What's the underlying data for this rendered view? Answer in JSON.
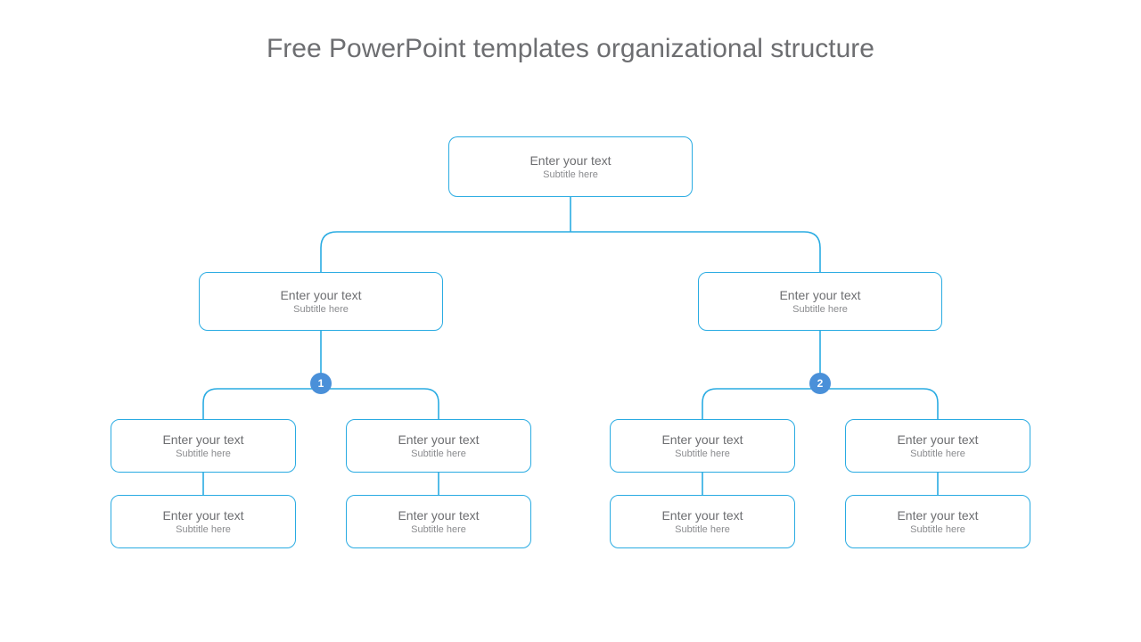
{
  "page": {
    "title": "Free PowerPoint templates organizational structure"
  },
  "colors": {
    "border": "#29abe2",
    "badge": "#4a90d9",
    "text": "#6d6e71",
    "sub": "#8a8b8e"
  },
  "nodes": {
    "root": {
      "title": "Enter your text",
      "subtitle": "Subtitle here"
    },
    "left": {
      "title": "Enter your text",
      "subtitle": "Subtitle here",
      "badge": "1"
    },
    "right": {
      "title": "Enter your text",
      "subtitle": "Subtitle here",
      "badge": "2"
    },
    "l1": {
      "title": "Enter your text",
      "subtitle": "Subtitle here"
    },
    "l2": {
      "title": "Enter your text",
      "subtitle": "Subtitle here"
    },
    "l3": {
      "title": "Enter your text",
      "subtitle": "Subtitle here"
    },
    "l4": {
      "title": "Enter your text",
      "subtitle": "Subtitle here"
    },
    "r1": {
      "title": "Enter your text",
      "subtitle": "Subtitle here"
    },
    "r2": {
      "title": "Enter your text",
      "subtitle": "Subtitle here"
    },
    "r3": {
      "title": "Enter your text",
      "subtitle": "Subtitle here"
    },
    "r4": {
      "title": "Enter your text",
      "subtitle": "Subtitle here"
    }
  },
  "chart_data": {
    "type": "tree",
    "title": "Free PowerPoint templates organizational structure",
    "root": {
      "title": "Enter your text",
      "subtitle": "Subtitle here",
      "children": [
        {
          "title": "Enter your text",
          "subtitle": "Subtitle here",
          "badge": "1",
          "children": [
            {
              "title": "Enter your text",
              "subtitle": "Subtitle here",
              "children": [
                {
                  "title": "Enter your text",
                  "subtitle": "Subtitle here"
                }
              ]
            },
            {
              "title": "Enter your text",
              "subtitle": "Subtitle here",
              "children": [
                {
                  "title": "Enter your text",
                  "subtitle": "Subtitle here"
                }
              ]
            }
          ]
        },
        {
          "title": "Enter your text",
          "subtitle": "Subtitle here",
          "badge": "2",
          "children": [
            {
              "title": "Enter your text",
              "subtitle": "Subtitle here",
              "children": [
                {
                  "title": "Enter your text",
                  "subtitle": "Subtitle here"
                }
              ]
            },
            {
              "title": "Enter your text",
              "subtitle": "Subtitle here",
              "children": [
                {
                  "title": "Enter your text",
                  "subtitle": "Subtitle here"
                }
              ]
            }
          ]
        }
      ]
    }
  }
}
